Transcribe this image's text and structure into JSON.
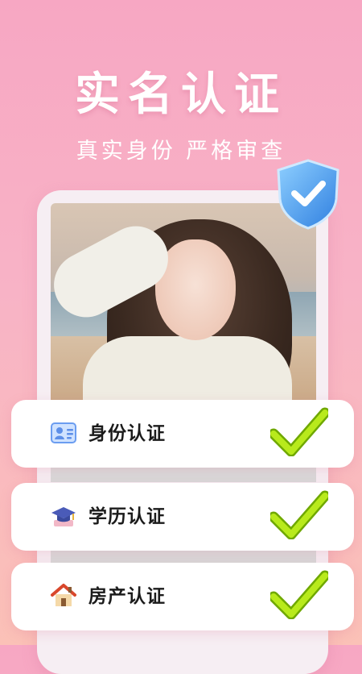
{
  "header": {
    "title": "实名认证",
    "subtitle": "真实身份 严格审查"
  },
  "verifications": [
    {
      "label": "身份认证",
      "icon": "id-card-icon",
      "status": "verified"
    },
    {
      "label": "学历认证",
      "icon": "graduation-cap-icon",
      "status": "verified"
    },
    {
      "label": "房产认证",
      "icon": "house-icon",
      "status": "verified"
    }
  ],
  "colors": {
    "accent_check": "#a6d90e",
    "shield_blue": "#3f98ee",
    "background_top": "#f7a7c3",
    "background_bottom": "#fbc1b7"
  }
}
